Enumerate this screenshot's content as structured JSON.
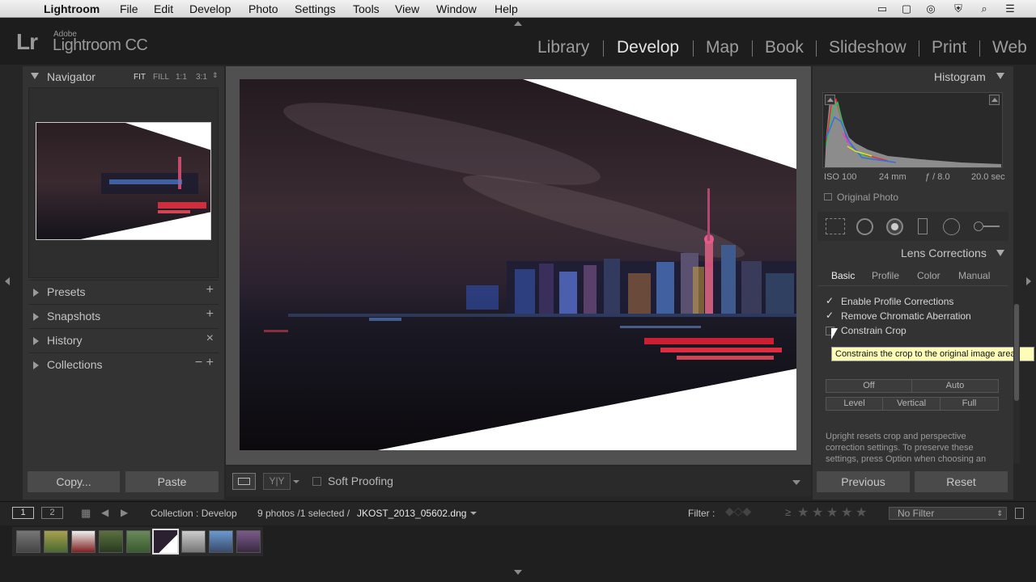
{
  "menubar": {
    "app_name": "Lightroom",
    "items": [
      "File",
      "Edit",
      "Develop",
      "Photo",
      "Settings",
      "Tools",
      "View",
      "Window",
      "Help"
    ]
  },
  "branding": {
    "mark": "Lr",
    "company": "Adobe",
    "product": "Lightroom CC"
  },
  "modules": [
    "Library",
    "Develop",
    "Map",
    "Book",
    "Slideshow",
    "Print",
    "Web"
  ],
  "active_module": "Develop",
  "navigator": {
    "title": "Navigator",
    "zoom_options": [
      "FIT",
      "FILL",
      "1:1",
      "3:1"
    ]
  },
  "left_sections": [
    {
      "label": "Presets",
      "action": "+"
    },
    {
      "label": "Snapshots",
      "action": "+"
    },
    {
      "label": "History",
      "action": "×"
    },
    {
      "label": "Collections",
      "action": "− +"
    }
  ],
  "left_buttons": {
    "copy": "Copy...",
    "paste": "Paste"
  },
  "toolbar": {
    "soft_proofing": "Soft Proofing"
  },
  "histogram": {
    "title": "Histogram",
    "iso": "ISO 100",
    "focal": "24 mm",
    "aperture": "ƒ / 8.0",
    "shutter": "20.0 sec",
    "original_photo": "Original Photo"
  },
  "lens_corrections": {
    "title": "Lens Corrections",
    "tabs": [
      "Basic",
      "Profile",
      "Color",
      "Manual"
    ],
    "active_tab": "Basic",
    "options": [
      {
        "label": "Enable Profile Corrections",
        "checked": true
      },
      {
        "label": "Remove Chromatic Aberration",
        "checked": true
      },
      {
        "label": "Constrain Crop",
        "checked": false
      }
    ],
    "tooltip": "Constrains the crop to the original image area",
    "upright_row1": [
      "Off",
      "Auto"
    ],
    "upright_row2": [
      "Level",
      "Vertical",
      "Full"
    ],
    "note": "Upright resets crop and perspective correction settings. To preserve these settings, press Option when choosing an"
  },
  "right_buttons": {
    "previous": "Previous",
    "reset": "Reset"
  },
  "filmstrip": {
    "page1": "1",
    "page2": "2",
    "collection": "Collection : Develop",
    "count": "9 photos /1 selected /",
    "filename": "JKOST_2013_05602.dng",
    "filter_label": "Filter :",
    "rating_op": "≥",
    "filter_value": "No Filter"
  },
  "colors": {
    "accent_tooltip": "#fdfdb8",
    "panel": "#333333",
    "background": "#262626"
  }
}
